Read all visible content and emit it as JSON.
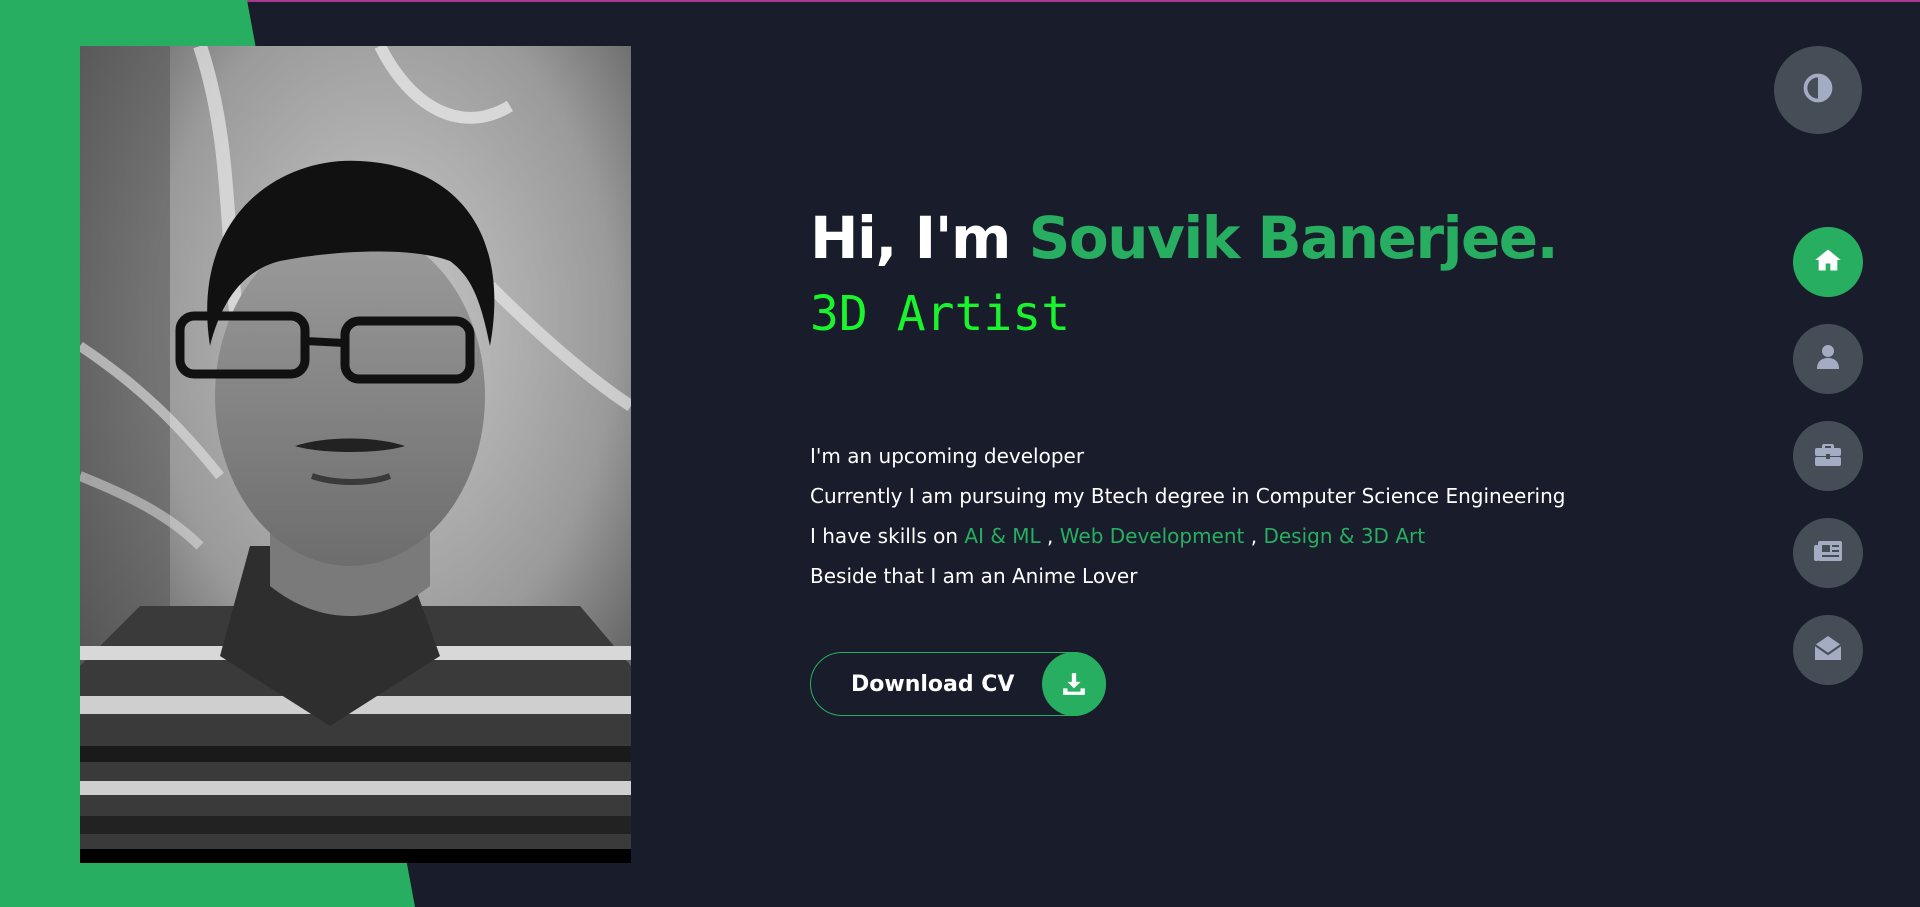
{
  "hero": {
    "greeting_prefix": "Hi, I'm ",
    "name": "Souvik Banerjee.",
    "role": "3D Artist"
  },
  "bio": {
    "line1": "I'm an upcoming developer",
    "line2": "Currently I am pursuing my Btech degree in Computer Science Engineering",
    "line3_prefix": "I have skills on ",
    "skills": [
      "AI & ML",
      "Web Development",
      "Design & 3D Art"
    ],
    "skill_separator": " , ",
    "line4": "Beside that I am an Anime Lover"
  },
  "cv_button": {
    "label": "Download CV",
    "icon": "download-icon"
  },
  "theme_toggle": {
    "icon": "contrast-icon"
  },
  "nav": {
    "items": [
      {
        "name": "home",
        "icon": "home-icon",
        "active": true
      },
      {
        "name": "about",
        "icon": "user-icon",
        "active": false
      },
      {
        "name": "portfolio",
        "icon": "briefcase-icon",
        "active": false
      },
      {
        "name": "blogs",
        "icon": "newspaper-icon",
        "active": false
      },
      {
        "name": "contact",
        "icon": "envelope-open-icon",
        "active": false
      }
    ]
  },
  "colors": {
    "background": "#191d2b",
    "accent": "#27ae60",
    "role_text": "#19f52c",
    "nav_inactive": "#454e56",
    "icon_inactive": "#a4acc4"
  }
}
